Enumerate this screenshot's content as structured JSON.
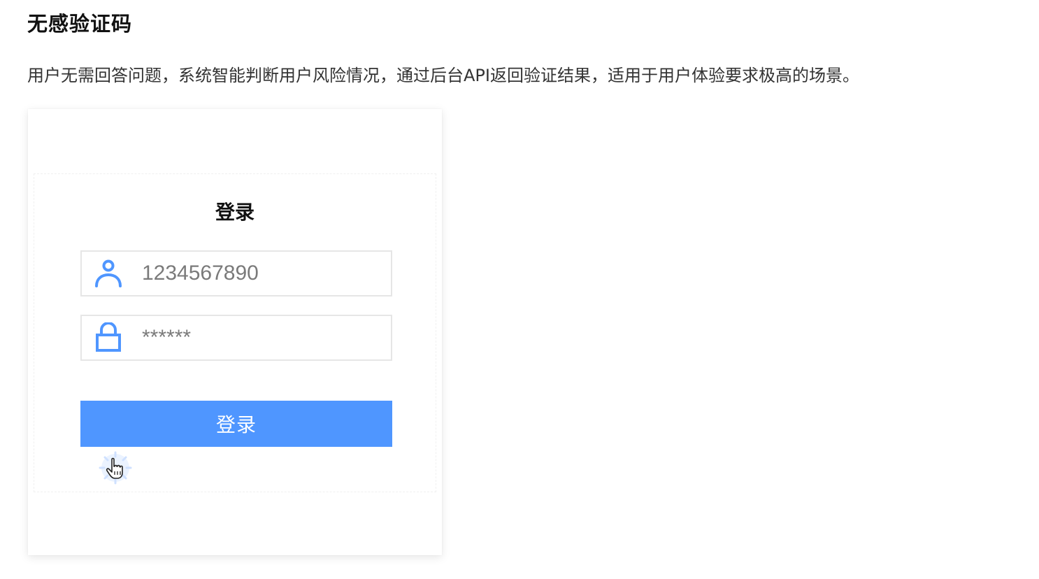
{
  "section": {
    "title": "无感验证码",
    "description": "用户无需回答问题，系统智能判断用户风险情况，通过后台API返回验证结果，适用于用户体验要求极高的场景。"
  },
  "login": {
    "title": "登录",
    "username_value": "1234567890",
    "password_value": "******",
    "submit_label": "登录",
    "accent_color": "#4f96ff"
  },
  "icons": {
    "username": "user-icon",
    "password": "lock-icon",
    "cursor": "pointer-hand-cursor-icon"
  }
}
